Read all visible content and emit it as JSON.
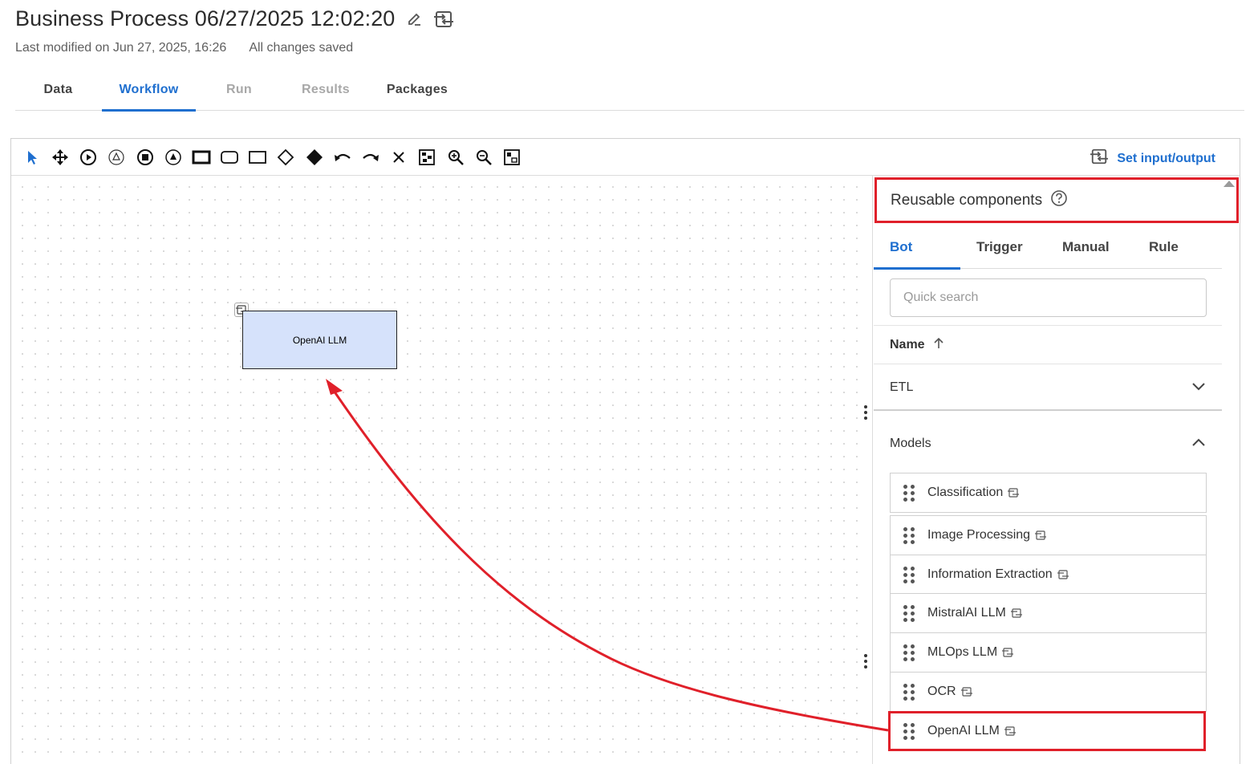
{
  "header": {
    "title": "Business Process 06/27/2025 12:02:20",
    "last_modified": "Last modified on Jun 27, 2025, 16:26",
    "save_status": "All changes saved"
  },
  "tabs": [
    {
      "label": "Data",
      "state": "normal"
    },
    {
      "label": "Workflow",
      "state": "active"
    },
    {
      "label": "Run",
      "state": "disabled"
    },
    {
      "label": "Results",
      "state": "disabled"
    },
    {
      "label": "Packages",
      "state": "normal"
    }
  ],
  "toolbar": {
    "tools": [
      "pointer-icon",
      "move-icon",
      "start-event-icon",
      "intermediate-event-icon",
      "end-event-icon",
      "escalation-event-icon",
      "task-bold-icon",
      "subprocess-icon",
      "task-icon",
      "gateway-icon",
      "gateway-filled-icon",
      "undo-icon",
      "redo-icon",
      "delete-icon",
      "fit-icon",
      "zoom-in-icon",
      "zoom-out-icon",
      "minimap-icon"
    ],
    "set_io_label": "Set input/output"
  },
  "canvas": {
    "node_label": "OpenAI LLM"
  },
  "panel": {
    "title": "Reusable components",
    "tabs": [
      "Bot",
      "Trigger",
      "Manual",
      "Rule"
    ],
    "search_placeholder": "Quick search",
    "sort_label": "Name",
    "groups": {
      "etl": "ETL",
      "models": "Models"
    },
    "items": [
      "Classification",
      "Image Processing",
      "Information Extraction",
      "MistralAI LLM",
      "MLOps LLM",
      "OCR",
      "OpenAI LLM"
    ]
  },
  "colors": {
    "accent": "#1f6fcf",
    "highlight": "#e0202a",
    "node_fill": "#d6e2fb"
  }
}
